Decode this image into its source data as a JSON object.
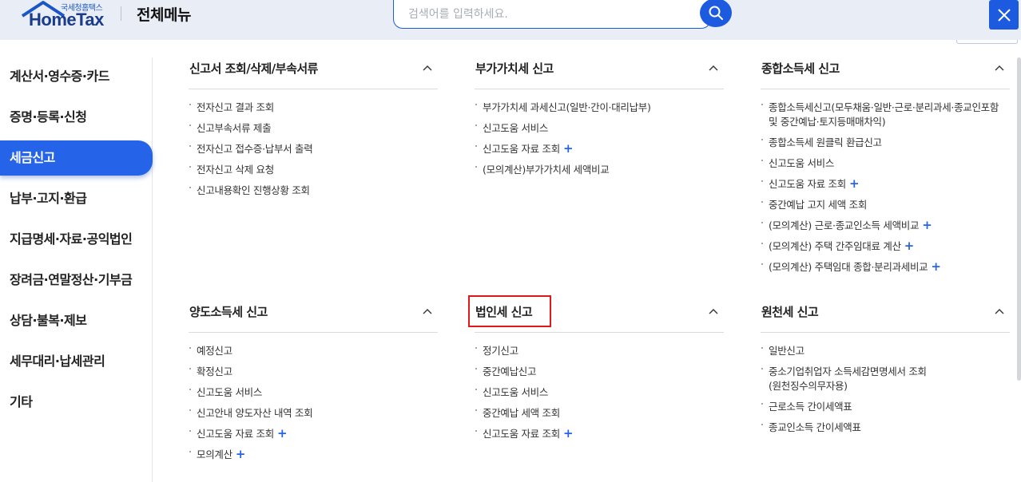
{
  "header": {
    "logo_sub": "국세청홈택스",
    "logo_main": "HomeTax",
    "title": "전체메뉴",
    "search_placeholder": "검색어를 입력하세요."
  },
  "sidebar": {
    "items": [
      {
        "label": "계산서·영수증·카드"
      },
      {
        "label": "증명·등록·신청"
      },
      {
        "label": "세금신고",
        "active": true
      },
      {
        "label": "납부·고지·환급"
      },
      {
        "label": "지급명세·자료·공익법인"
      },
      {
        "label": "장려금·연말정산·기부금"
      },
      {
        "label": "상담·불복·제보"
      },
      {
        "label": "세무대리·납세관리"
      },
      {
        "label": "기타"
      }
    ]
  },
  "sections": [
    {
      "title": "신고서 조회/삭제/부속서류",
      "items": [
        "전자신고 결과 조회",
        "신고부속서류 제출",
        "전자신고 접수증·납부서 출력",
        "전자신고 삭제 요청",
        "신고내용확인 진행상황 조회"
      ]
    },
    {
      "title": "부가가치세 신고",
      "items": [
        "부가가치세 과세신고(일반·간이·대리납부)",
        "신고도움 서비스",
        "신고도움 자료 조회",
        "(모의계산)부가가치세 세액비교"
      ]
    },
    {
      "title": "종합소득세 신고",
      "items": [
        "종합소득세신고(모두채움·일반·근로·분리과세·종교인포함",
        "및 중간예납·토지등매매차익)",
        "종합소득세 원클릭 환급신고",
        "신고도움 서비스",
        "신고도움 자료 조회",
        "중간예납 고지 세액 조회",
        "(모의계산) 근로·종교인소득 세액비교",
        "(모의계산) 주택 간주임대료 계산",
        "(모의계산) 주택임대 종합·분리과세비교"
      ]
    },
    {
      "title": "양도소득세 신고",
      "items": [
        "예정신고",
        "확정신고",
        "신고도움 서비스",
        "신고안내 양도자산 내역 조회",
        "신고도움 자료 조회",
        "모의계산"
      ]
    },
    {
      "title": "법인세 신고",
      "items": [
        "정기신고",
        "중간예납신고",
        "신고도움 서비스",
        "중간예납 세액 조회",
        "신고도움 자료 조회"
      ]
    },
    {
      "title": "원천세 신고",
      "items": [
        "일반신고",
        "중소기업취업자 소득세감면명세서 조회",
        "(원천징수의무자용)",
        "근로소득 간이세액표",
        "종교인소득 간이세액표"
      ]
    }
  ],
  "plus_symbol": "+",
  "colors": {
    "accent": "#2563e8",
    "highlight": "#e01818"
  }
}
